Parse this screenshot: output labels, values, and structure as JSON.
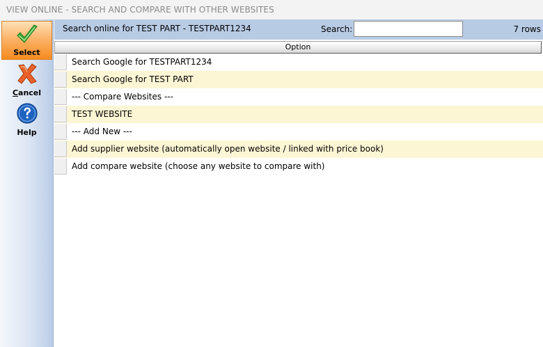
{
  "window": {
    "title": "VIEW ONLINE - SEARCH AND COMPARE WITH OTHER WEBSITES"
  },
  "sidebar": {
    "select": {
      "label": "Select",
      "icon": "checkmark-icon",
      "color": "#2f9e2f"
    },
    "cancel": {
      "label_underline": "C",
      "label_rest": "ancel",
      "icon": "cancel-x-icon",
      "color": "#e0571b"
    },
    "help": {
      "label": "Help",
      "icon": "help-question-icon",
      "color": "#1e5fb8"
    }
  },
  "toolbar": {
    "title": "Search online for TEST PART  - TESTPART1234",
    "search_label": "Search:",
    "search_value": "",
    "row_count": "7 rows"
  },
  "grid": {
    "column_header": "Option",
    "rows": [
      "Search Google for TESTPART1234",
      "Search Google for TEST PART",
      "--- Compare Websites ---",
      "TEST WEBSITE",
      "--- Add New ---",
      "Add supplier website (automatically open website / linked with price book)",
      "Add compare website (choose any website to compare with)"
    ]
  },
  "colors": {
    "toolbar_bg": "#b8cbe4",
    "alt_row_bg": "#fdf6d5",
    "active_button": "#f68b1f"
  }
}
